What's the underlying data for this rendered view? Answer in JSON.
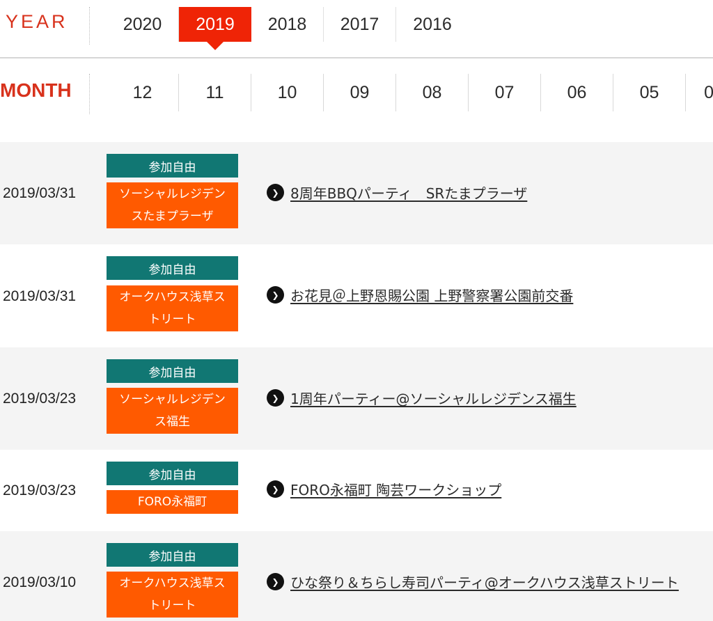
{
  "year_nav": {
    "label": "YEAR",
    "years": [
      "2020",
      "2019",
      "2018",
      "2017",
      "2016"
    ],
    "active": "2019"
  },
  "month_nav": {
    "label": "MONTH",
    "months": [
      "12",
      "11",
      "10",
      "09",
      "08",
      "07",
      "06",
      "05",
      "0"
    ]
  },
  "events": [
    {
      "date": "2019/03/31",
      "tag": "参加自由",
      "place": "ソーシャルレジデンスたまプラーザ",
      "title": "8周年BBQパーティ　SRたまプラーザ"
    },
    {
      "date": "2019/03/31",
      "tag": "参加自由",
      "place": "オークハウス浅草ストリート",
      "title": "お花見＠上野恩賜公園 上野警察署公園前交番"
    },
    {
      "date": "2019/03/23",
      "tag": "参加自由",
      "place": "ソーシャルレジデンス福生",
      "title": "1周年パーティー@ソーシャルレジデンス福生"
    },
    {
      "date": "2019/03/23",
      "tag": "参加自由",
      "place": "FORO永福町",
      "title": "FORO永福町 陶芸ワークショップ"
    },
    {
      "date": "2019/03/10",
      "tag": "参加自由",
      "place": "オークハウス浅草ストリート",
      "title": "ひな祭り＆ちらし寿司パーティ@オークハウス浅草ストリート"
    }
  ],
  "colors": {
    "accent_red": "#ef2406",
    "label_red": "#d8321c",
    "tag_teal": "#117773",
    "tag_orange": "#ff5a00"
  },
  "icons": {
    "link_bullet": "chevron-right-circle-icon"
  }
}
